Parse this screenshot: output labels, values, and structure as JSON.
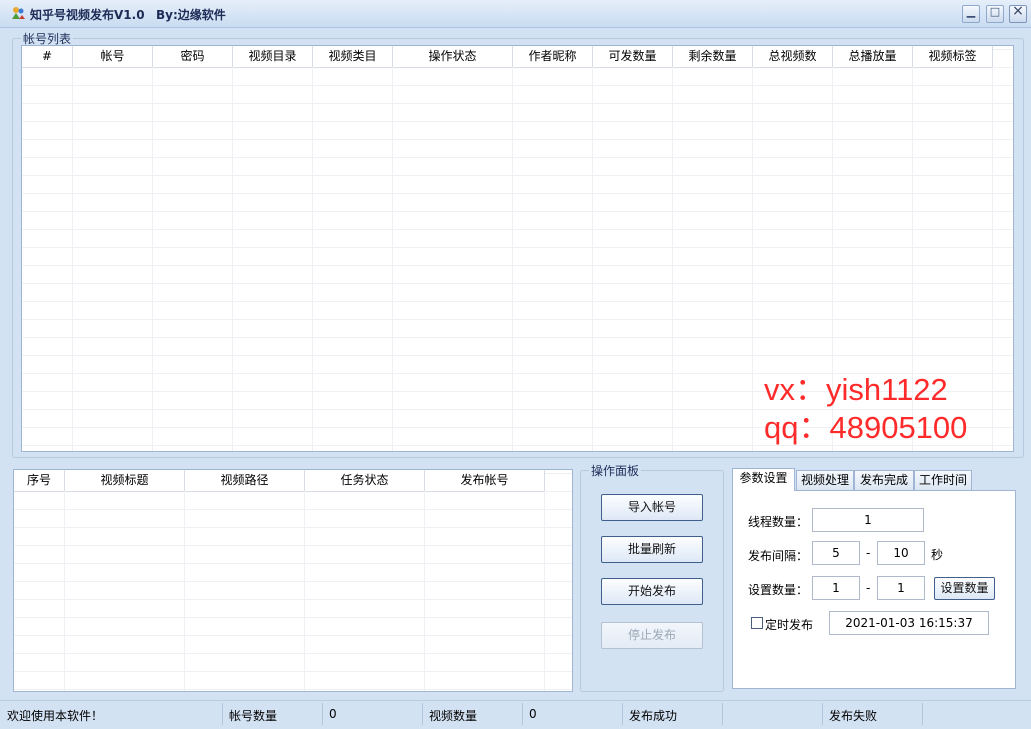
{
  "window": {
    "title": "知乎号视频发布V1.0",
    "author": "By:边缘软件",
    "controls": {
      "minimize": "▁",
      "maximize": "□",
      "close": "×"
    }
  },
  "accounts": {
    "group_title": "帐号列表",
    "columns": [
      "#",
      "帐号",
      "密码",
      "视频目录",
      "视频类目",
      "操作状态",
      "作者昵称",
      "可发数量",
      "剩余数量",
      "总视频数",
      "总播放量",
      "视频标签"
    ],
    "rows": []
  },
  "watermark": {
    "line1": "vx：yish1122",
    "line2": "qq：48905100"
  },
  "videos": {
    "columns": [
      "序号",
      "视频标题",
      "视频路径",
      "任务状态",
      "发布帐号"
    ],
    "rows": []
  },
  "ops": {
    "group_title": "操作面板",
    "import": "导入帐号",
    "refresh": "批量刷新",
    "start": "开始发布",
    "stop": "停止发布"
  },
  "tabs": [
    "参数设置",
    "视频处理",
    "发布完成",
    "工作时间"
  ],
  "settings": {
    "threads_label": "线程数量：",
    "threads_value": "1",
    "interval_label": "发布间隔：",
    "interval_min": "5",
    "interval_max": "10",
    "interval_unit": "秒",
    "dash": "-",
    "count_label": "设置数量：",
    "count_min": "1",
    "count_max": "1",
    "set_count_button": "设置数量",
    "schedule_label": "定时发布",
    "schedule_checked": false,
    "schedule_datetime": "2021-01-03 16:15:37"
  },
  "status": {
    "welcome": "欢迎使用本软件！",
    "account_count_label": "帐号数量",
    "account_count": "0",
    "video_count_label": "视频数量",
    "video_count": "0",
    "success_label": "发布成功",
    "fail_label": "发布失败"
  },
  "colors": {
    "accent": "#1d2b57",
    "watermark": "#ff2a2a",
    "background": "#d3e2f3"
  }
}
